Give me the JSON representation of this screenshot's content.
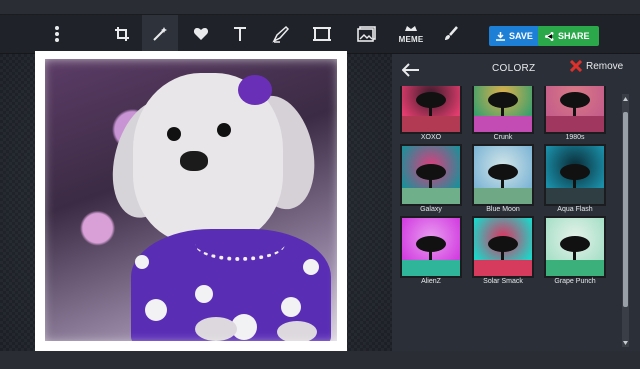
{
  "toolbar": {
    "icons": [
      "more-vertical-icon",
      "crop-icon",
      "magic-wand-icon",
      "heart-icon",
      "text-icon",
      "draw-icon",
      "frame-icon",
      "sticker-icon",
      "meme-icon",
      "paint-brush-icon"
    ],
    "meme_label": "MEME",
    "save_label": "SAVE",
    "share_label": "SHARE",
    "save_color": "#1e7fd6",
    "share_color": "#2aa84a"
  },
  "sidebar": {
    "title": "COLORZ",
    "remove_label": "Remove",
    "filters": [
      {
        "label": "XOXO",
        "sky": "#e23d6f",
        "sky2": "#3a1b2a",
        "ground": "#b23a52",
        "selected": true
      },
      {
        "label": "Crunk",
        "sky": "#3ca06c",
        "sky2": "#e4b04a",
        "ground": "#c24bb4",
        "selected": false
      },
      {
        "label": "1980s",
        "sky": "#c55d8a",
        "sky2": "#d97a86",
        "ground": "#a0375f",
        "selected": false
      },
      {
        "label": "Galaxy",
        "sky": "#1e8f99",
        "sky2": "#e03c7c",
        "ground": "#6fb08a",
        "selected": false
      },
      {
        "label": "Blue Moon",
        "sky": "#7fb6d6",
        "sky2": "#d3e6e8",
        "ground": "#6fa884",
        "selected": false
      },
      {
        "label": "Aqua Flash",
        "sky": "#1a8fa8",
        "sky2": "#0a2a35",
        "ground": "#2f3e43",
        "selected": false
      },
      {
        "label": "AlienZ",
        "sky": "#d23fe0",
        "sky2": "#e99df0",
        "ground": "#2fb59a",
        "selected": false
      },
      {
        "label": "Solar Smack",
        "sky": "#1dd6c9",
        "sky2": "#e32f5d",
        "ground": "#d63a5c",
        "selected": false
      },
      {
        "label": "Grape Punch",
        "sky": "#a8e0c8",
        "sky2": "#e6f2ea",
        "ground": "#3cb07a",
        "selected": false
      }
    ]
  }
}
